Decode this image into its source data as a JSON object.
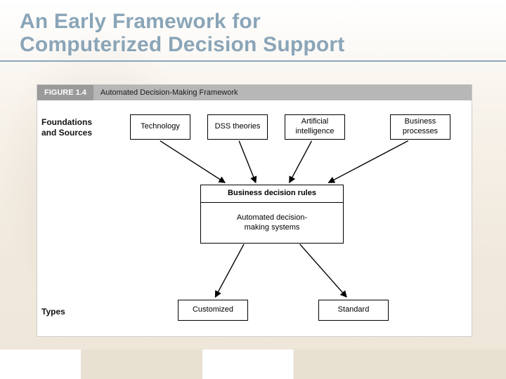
{
  "title_line1": "An Early Framework for",
  "title_line2": "Computerized Decision Support",
  "figure": {
    "number": "FIGURE 1.4",
    "caption": "Automated Decision-Making Framework"
  },
  "rows": {
    "foundations_label": "Foundations\nand Sources",
    "types_label": "Types"
  },
  "sources": {
    "technology": "Technology",
    "dss": "DSS theories",
    "ai": "Artificial\nintelligence",
    "business": "Business\nprocesses"
  },
  "center": {
    "rules": "Business decision rules",
    "systems": "Automated decision-\nmaking systems"
  },
  "types": {
    "customized": "Customized",
    "standard": "Standard"
  }
}
